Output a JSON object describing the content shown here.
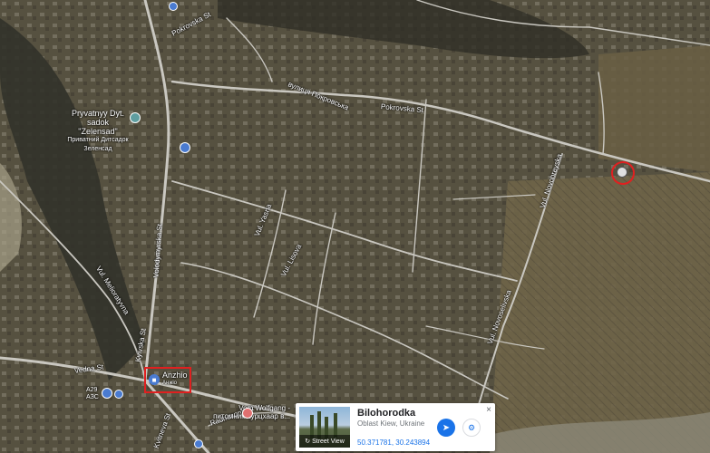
{
  "map": {
    "colors": {
      "terrain": "#57513f",
      "field": "#6b6148",
      "forest": "#3b3a2d",
      "road": "#c9c7c0"
    }
  },
  "streets": [
    {
      "id": "pokrovska-top",
      "text": "Pokrovska St"
    },
    {
      "id": "vulytsia-pokrovska",
      "text": "вулиця Покровська"
    },
    {
      "id": "pokrovska-right",
      "text": "Pokrovska St"
    },
    {
      "id": "volodymyrska",
      "text": "Volodymyrska St"
    },
    {
      "id": "meliorativna",
      "text": "Vul. Melioratyvna"
    },
    {
      "id": "vul-yasna",
      "text": "Vul. Yasna"
    },
    {
      "id": "kyivska",
      "text": "Kyivska St"
    },
    {
      "id": "vul-novohreyska",
      "text": "Vul. Novohreyska"
    },
    {
      "id": "vul-lisova",
      "text": "Vul. Lisova"
    },
    {
      "id": "vul-novoselivska",
      "text": "Vul. Novoselivska"
    },
    {
      "id": "kvitneva",
      "text": "Kvitneva St"
    },
    {
      "id": "vedna",
      "text": "Vedna St"
    },
    {
      "id": "radhospna",
      "text": "Radhospna St"
    }
  ],
  "places": {
    "kindergarten": {
      "name": "Pryvatnyy Dyt. sadok \"Zelensad\"",
      "name_local": "Приватний Дитсадок Зеленсад"
    },
    "anzhio": {
      "name": "Anzhio",
      "name_local": "Анжіо"
    },
    "vom_wolfgang": {
      "name": "Vom Wolfgang - питомник Курцхаар в..."
    },
    "gas": {
      "name": "A29",
      "name_local": "АЗС"
    }
  },
  "card": {
    "title": "Bilohorodka",
    "subtitle": "Oblast Kiew, Ukraine",
    "coordinates": "50.371781, 30.243894",
    "street_view_label": "Street View",
    "close": "×"
  }
}
